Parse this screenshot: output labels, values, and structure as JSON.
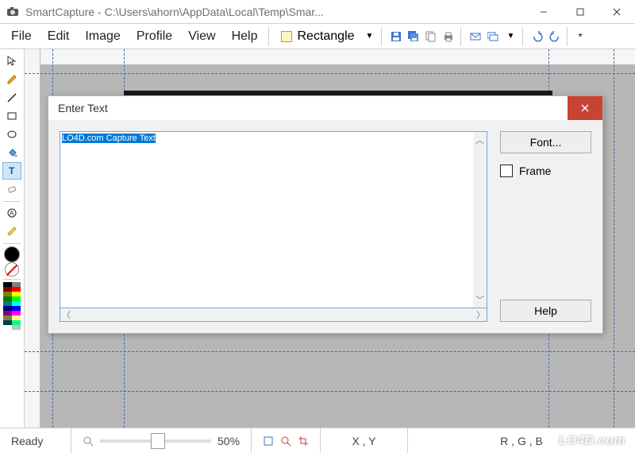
{
  "window": {
    "title": "SmartCapture - C:\\Users\\ahorn\\AppData\\Local\\Temp\\Smar...",
    "buttons": {
      "minimize": "Minimize",
      "maximize": "Maximize",
      "close": "Close"
    }
  },
  "menu": {
    "file": "File",
    "edit": "Edit",
    "image": "Image",
    "profile": "Profile",
    "view": "View",
    "help": "Help"
  },
  "toolbar": {
    "capture_mode": "Rectangle",
    "dropdown_glyph": "▼",
    "star": "*"
  },
  "tools": {
    "pointer": "pointer",
    "pencil": "pencil",
    "line": "line",
    "rectangle": "rectangle",
    "ellipse": "ellipse",
    "fill": "fill",
    "text": "text",
    "eraser": "eraser",
    "stamp": "stamp",
    "highlighter": "highlighter"
  },
  "dialog": {
    "title": "Enter Text",
    "text_value": "LO4D.com Capture Text",
    "font_btn": "Font...",
    "frame_chk": "Frame",
    "help_btn": "Help"
  },
  "statusbar": {
    "status": "Ready",
    "zoom_pct": "50%",
    "coords": "X , Y",
    "rgb": "R , G , B"
  },
  "watermark": "LO4D.com"
}
